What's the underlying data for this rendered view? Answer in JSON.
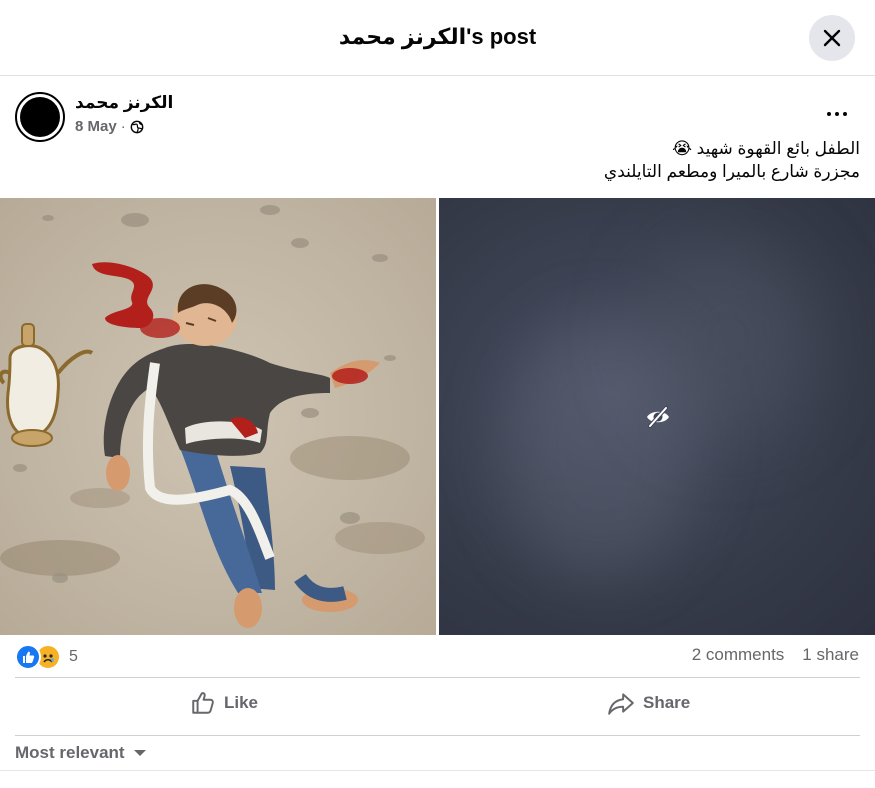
{
  "header": {
    "title": "الكرنز محمد's post",
    "close_icon": "close-icon"
  },
  "post": {
    "author": "الكرنز محمد",
    "date": "8 May",
    "separator": "·",
    "privacy_icon": "globe-icon",
    "more_icon": "more-horizontal-icon",
    "text_lines": [
      "الطفل بائع القهوة شهيد 😭",
      "مجزرة شارع بالميرا ومطعم التايلندي"
    ],
    "images": [
      {
        "type": "illustration",
        "blurred": false
      },
      {
        "type": "sensitive-content",
        "blurred": true,
        "icon": "eye-slash-icon"
      }
    ]
  },
  "reactions": {
    "icons": [
      "like",
      "sad"
    ],
    "count": "5"
  },
  "stats": {
    "comments": "2 comments",
    "shares": "1 share"
  },
  "actions": {
    "like_label": "Like",
    "share_label": "Share"
  },
  "comments": {
    "sort_label": "Most relevant"
  },
  "colors": {
    "like_blue": "#1877f2",
    "secondary_text": "#65676b",
    "close_bg": "#e4e6eb"
  }
}
